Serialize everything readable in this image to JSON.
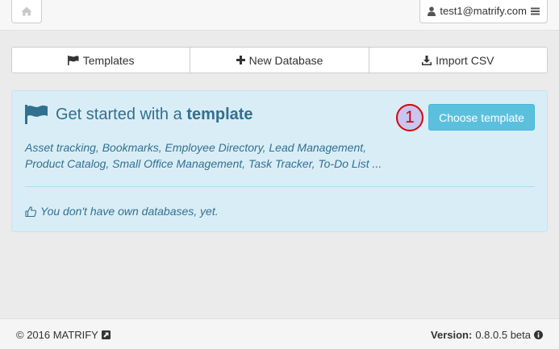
{
  "navbar": {
    "home_icon": "home-icon",
    "user_icon": "user-icon",
    "user_label": "test1@matrify.com",
    "menu_icon": "hamburger-icon"
  },
  "toolbar": {
    "buttons": [
      {
        "icon": "flag-icon",
        "label": "Templates"
      },
      {
        "icon": "plus-icon",
        "label": "New Database"
      },
      {
        "icon": "download-icon",
        "label": "Import CSV"
      }
    ]
  },
  "panel": {
    "title_prefix": "Get started with a",
    "title_bold": "template",
    "step_number": "1",
    "choose_button": "Choose template",
    "description": "Asset tracking, Bookmarks, Employee Directory, Lead Management, Product Catalog, Small Office Management, Task Tracker, To-Do List ...",
    "note": "You don't have own databases, yet.",
    "note_icon": "thumbs-up-icon",
    "colors": {
      "bg": "#d9edf7",
      "text": "#31708f",
      "button": "#5bc0de",
      "badge_ring": "#dd0000"
    }
  },
  "footer": {
    "copyright": "© 2016 MATRIFY",
    "external_icon": "external-link-icon",
    "version_label": "Version:",
    "version_value": "0.8.0.5 beta",
    "info_icon": "info-icon"
  }
}
